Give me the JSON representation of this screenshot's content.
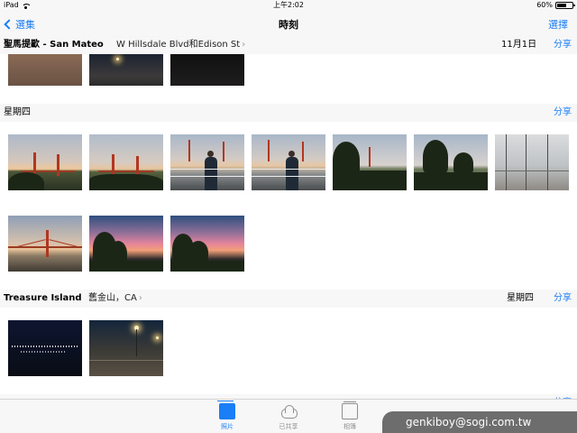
{
  "status": {
    "device": "iPad",
    "time": "上午2:02",
    "battery": "60%",
    "battery_level": 0.6
  },
  "nav": {
    "back_label": "選集",
    "title": "時刻",
    "select_label": "選擇"
  },
  "sections": [
    {
      "location": "聖馬提歐 - San Mateo",
      "sublocation": "W Hillsdale Blvd和Edison St",
      "date": "11月1日",
      "share": "分享"
    },
    {
      "location": "星期四",
      "sublocation": "",
      "date": "",
      "share": "分享"
    },
    {
      "location": "Treasure Island",
      "sublocation": "舊金山，CA",
      "date": "星期四",
      "share": "分享"
    },
    {
      "location": "",
      "sublocation": "",
      "date": "",
      "share": "分享"
    }
  ],
  "tabs": [
    {
      "label": "照片",
      "icon": "photos-icon",
      "active": true
    },
    {
      "label": "已共享",
      "icon": "cloud-icon",
      "active": false
    },
    {
      "label": "相簿",
      "icon": "albums-icon",
      "active": false
    }
  ],
  "watermark": "genkiboy@sogi.com.tw",
  "colors": {
    "accent": "#1a7ef6",
    "bar": "#f7f7f7"
  }
}
